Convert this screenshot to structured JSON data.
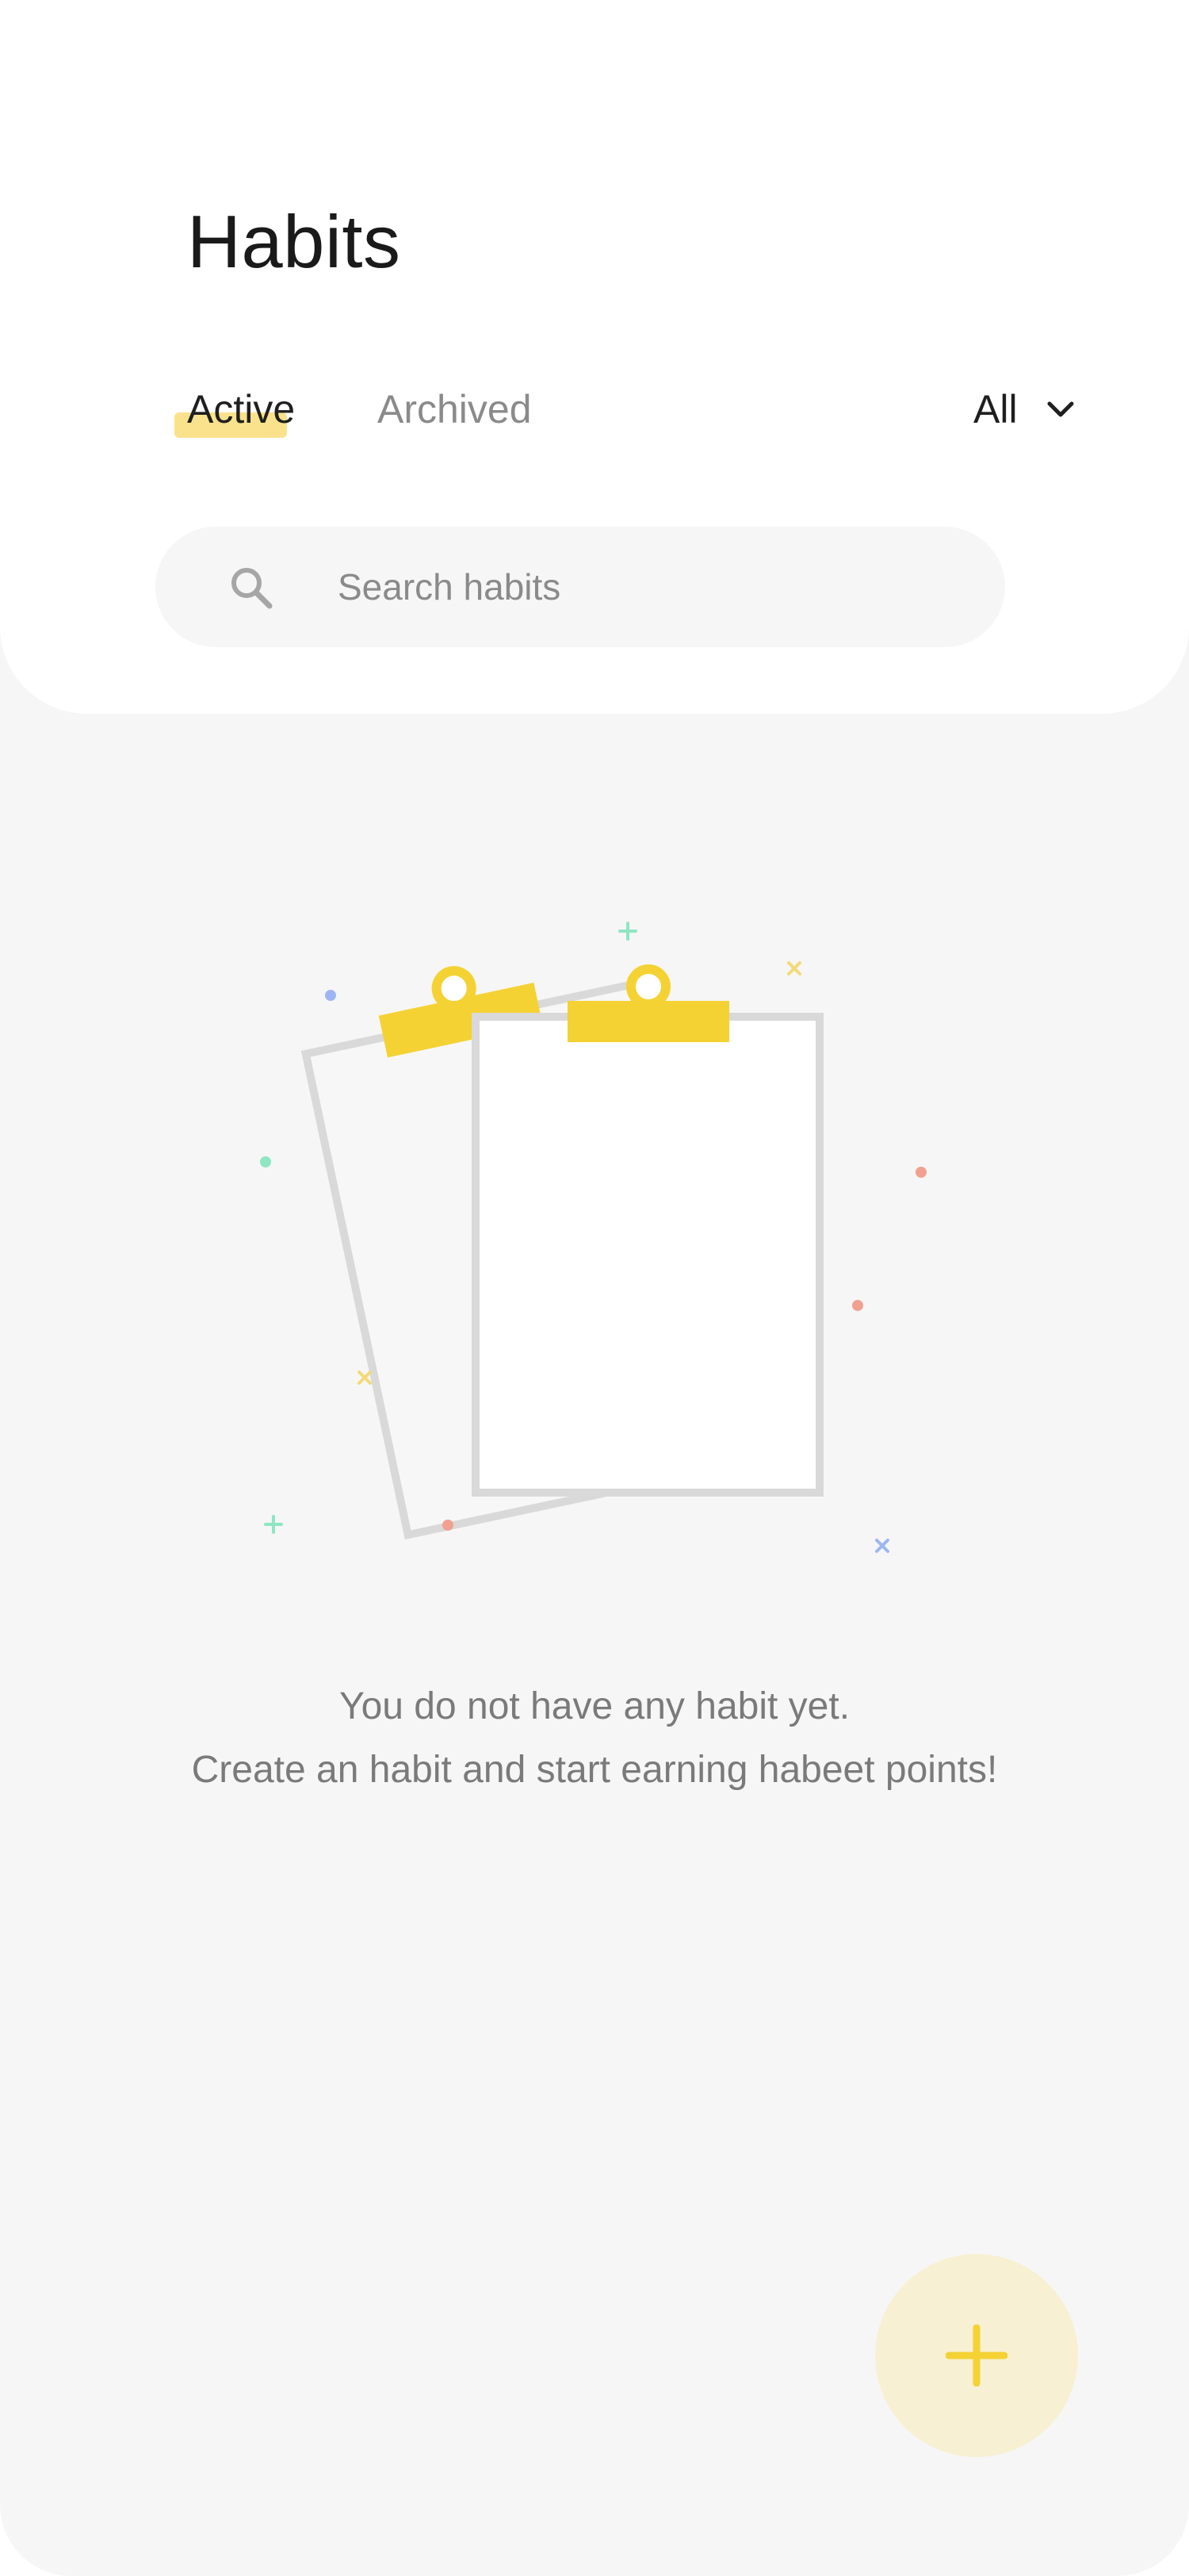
{
  "header": {
    "title": "Habits"
  },
  "tabs": [
    {
      "label": "Active",
      "selected": true
    },
    {
      "label": "Archived",
      "selected": false
    }
  ],
  "filter": {
    "selected": "All",
    "icon": "chevron-down-icon"
  },
  "search": {
    "placeholder": "Search habits",
    "value": "",
    "icon": "search-icon"
  },
  "empty_state": {
    "illustration": "clipboards-illustration",
    "line1": "You do not have any habit yet.",
    "line2": "Create an habit and start earning habeet points!"
  },
  "fab": {
    "icon": "plus-icon"
  },
  "colors": {
    "accent": "#f4d233",
    "accent_soft": "#f8f0d2",
    "tab_highlight": "#fae28c",
    "background": "#f6f6f6",
    "card": "#ffffff",
    "text_primary": "#1a1a1a",
    "text_secondary": "#7a7a7a"
  }
}
